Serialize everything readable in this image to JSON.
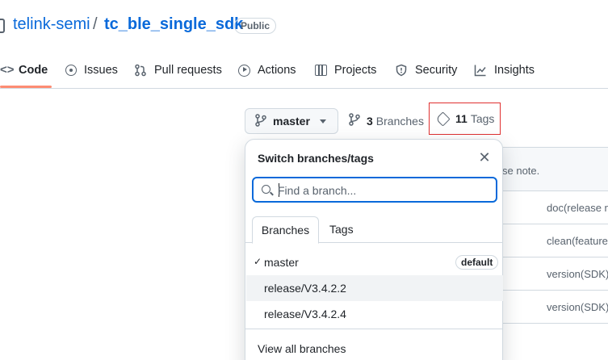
{
  "repo": {
    "owner": "telink-semi",
    "separator": "/",
    "name": "tc_ble_single_sdk",
    "visibility": "Public"
  },
  "nav": {
    "items": [
      {
        "label": "Code",
        "icon": "code-icon",
        "active": true
      },
      {
        "label": "Issues",
        "icon": "issue-icon"
      },
      {
        "label": "Pull requests",
        "icon": "pull-request-icon"
      },
      {
        "label": "Actions",
        "icon": "play-icon"
      },
      {
        "label": "Projects",
        "icon": "table-icon"
      },
      {
        "label": "Security",
        "icon": "shield-icon"
      },
      {
        "label": "Insights",
        "icon": "graph-icon"
      }
    ]
  },
  "toolbar": {
    "branch_label": "master",
    "branches_count": "3",
    "branches_label": "Branches",
    "tags_count": "11",
    "tags_label": "Tags"
  },
  "file_table": {
    "header_text": "se note.",
    "rows": [
      "doc(release n",
      "clean(feature",
      "version(SDK)",
      "version(SDK)"
    ]
  },
  "dropdown": {
    "title": "Switch branches/tags",
    "search_placeholder": "Find a branch...",
    "tabs": [
      "Branches",
      "Tags"
    ],
    "items": [
      {
        "label": "master",
        "checked": true,
        "badge": "default"
      },
      {
        "label": "release/V3.4.2.2"
      },
      {
        "label": "release/V3.4.2.4"
      }
    ],
    "footer_link": "View all branches"
  },
  "colors": {
    "link": "#0969da",
    "underline": "#fd8c73",
    "highlight_border": "#e03030"
  }
}
